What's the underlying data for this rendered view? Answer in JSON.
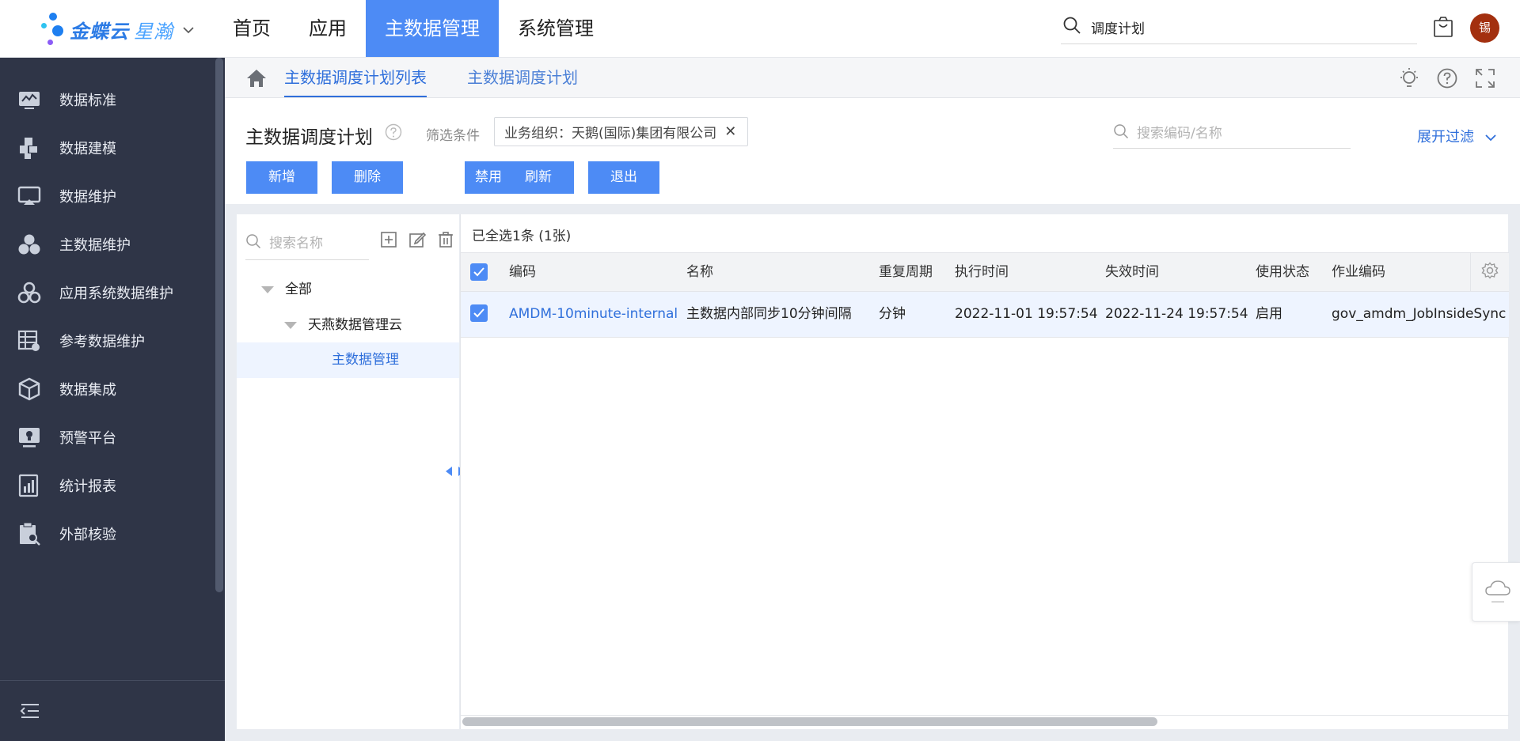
{
  "app": {
    "logo_text": "金蝶云",
    "logo_sub": "星瀚",
    "colors": {
      "primary": "#4d8bf5",
      "sidebar_bg": "#2f3547",
      "link": "#2f6fdb",
      "avatar_bg": "#a3300f"
    }
  },
  "topnav": {
    "items": [
      "首页",
      "应用",
      "主数据管理",
      "系统管理"
    ],
    "active_index": 2,
    "search_value": "调度计划",
    "avatar_text": "锡"
  },
  "sidebar": {
    "items": [
      {
        "label": "数据标准",
        "icon": "chart-monitor-icon"
      },
      {
        "label": "数据建模",
        "icon": "puzzle-icon"
      },
      {
        "label": "数据维护",
        "icon": "screen-icon"
      },
      {
        "label": "主数据维护",
        "icon": "cluster-icon"
      },
      {
        "label": "应用系统数据维护",
        "icon": "gears-icon"
      },
      {
        "label": "参考数据维护",
        "icon": "table-gear-icon"
      },
      {
        "label": "数据集成",
        "icon": "cube-icon"
      },
      {
        "label": "预警平台",
        "icon": "alert-monitor-icon"
      },
      {
        "label": "统计报表",
        "icon": "report-icon"
      },
      {
        "label": "外部核验",
        "icon": "clipboard-search-icon"
      }
    ]
  },
  "tabs": {
    "items": [
      "主数据调度计划列表",
      "主数据调度计划"
    ],
    "active_index": 0
  },
  "header": {
    "title": "主数据调度计划",
    "filter_label": "筛选条件",
    "filter_chip": "业务组织：天鹅(国际)集团有限公司",
    "search_placeholder": "搜索编码/名称",
    "expand_filter": "展开过滤"
  },
  "toolbar": {
    "add": "新增",
    "delete": "删除",
    "disable": "禁用",
    "refresh": "刷新",
    "exit": "退出"
  },
  "tree": {
    "search_placeholder": "搜索名称",
    "nodes": [
      "全部",
      "天燕数据管理云",
      "主数据管理"
    ]
  },
  "table": {
    "selection_info": "已全选1条 (1张)",
    "columns": [
      "编码",
      "名称",
      "重复周期",
      "执行时间",
      "失效时间",
      "使用状态",
      "作业编码"
    ],
    "rows": [
      {
        "code": "AMDM-10minute-internal",
        "name": "主数据内部同步10分钟间隔",
        "period": "分钟",
        "exec_time": "2022-11-01 19:57:54",
        "expire_time": "2022-11-24 19:57:54",
        "status": "启用",
        "job_code": "gov_amdm_JobInsideSync"
      }
    ]
  }
}
